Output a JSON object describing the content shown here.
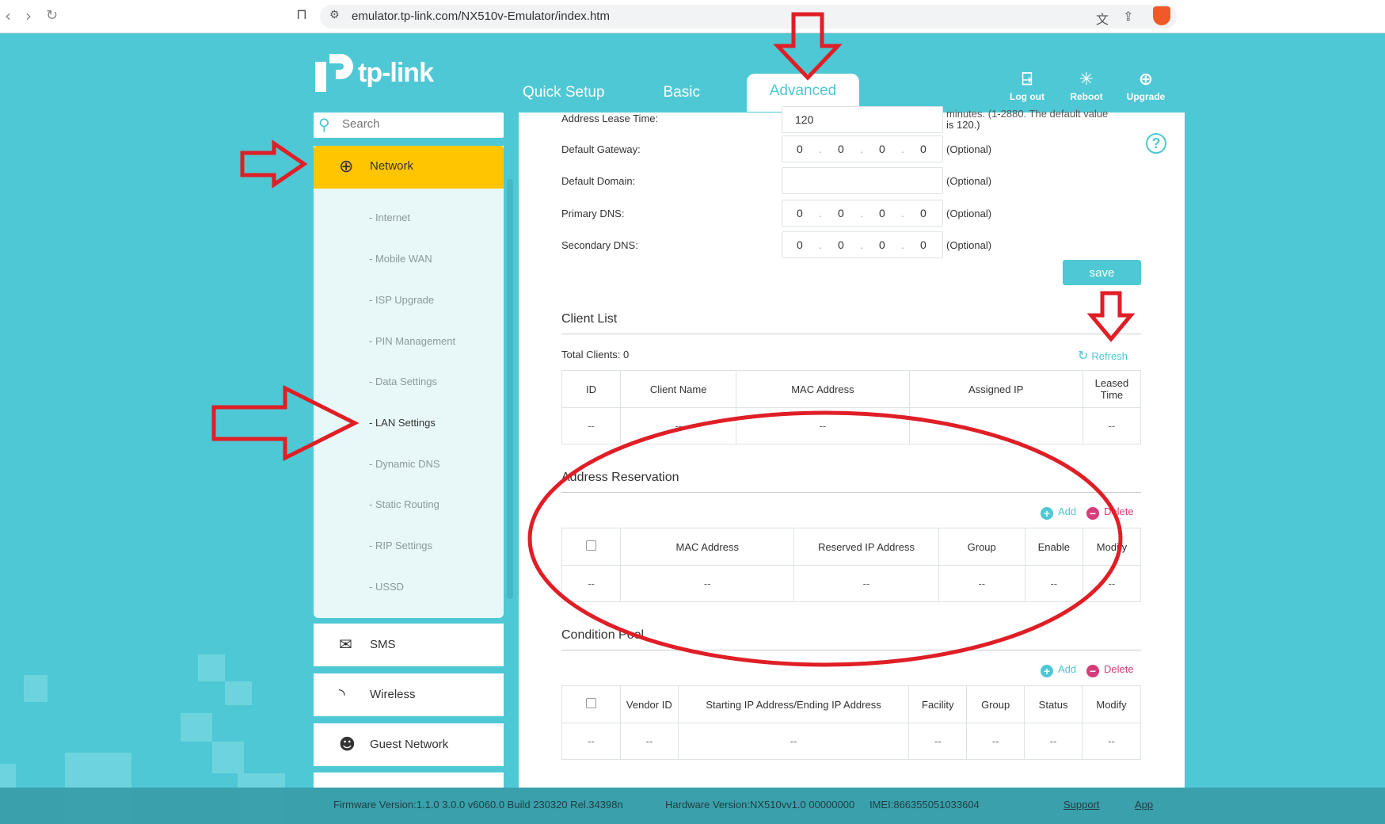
{
  "browser": {
    "url": "emulator.tp-link.com/NX510v-Emulator/index.htm"
  },
  "brand": {
    "logo_text": "tp-link",
    "accent": "#4ec8d4",
    "active_color": "#ffc500"
  },
  "top_nav": {
    "tabs": [
      {
        "label": "Quick Setup"
      },
      {
        "label": "Basic"
      },
      {
        "label": "Advanced",
        "active": true
      }
    ],
    "tools": [
      {
        "label": "Log out",
        "icon": "logout-icon"
      },
      {
        "label": "Reboot",
        "icon": "reboot-icon"
      },
      {
        "label": "Upgrade",
        "icon": "upgrade-icon"
      }
    ]
  },
  "sidebar": {
    "search_placeholder": "Search",
    "active_section": {
      "label": "Network",
      "icon": "globe-icon"
    },
    "sub_items": [
      {
        "label": "- Internet"
      },
      {
        "label": "- Mobile WAN"
      },
      {
        "label": "- ISP Upgrade"
      },
      {
        "label": "- PIN Management"
      },
      {
        "label": "- Data Settings"
      },
      {
        "label": "- LAN Settings",
        "current": true
      },
      {
        "label": "- Dynamic DNS"
      },
      {
        "label": "- Static Routing"
      },
      {
        "label": "- RIP Settings"
      },
      {
        "label": "- USSD"
      }
    ],
    "sections": [
      {
        "label": "SMS",
        "icon": "envelope-icon"
      },
      {
        "label": "Wireless",
        "icon": "wireless-icon"
      },
      {
        "label": "Guest Network",
        "icon": "guest-icon"
      }
    ]
  },
  "form": {
    "lease_label": "Address Lease Time:",
    "lease_value": "120",
    "lease_hint_1": "minutes. (1-2880. The default value",
    "lease_hint_2": "is 120.)",
    "gateway_label": "Default Gateway:",
    "domain_label": "Default Domain:",
    "primary_dns_label": "Primary DNS:",
    "secondary_dns_label": "Secondary DNS:",
    "optional": "(Optional)",
    "octet": "0",
    "save_label": "save"
  },
  "client_list": {
    "title": "Client List",
    "total": "Total Clients: 0",
    "refresh_label": "Refresh",
    "columns": [
      "ID",
      "Client Name",
      "MAC Address",
      "Assigned IP",
      "Leased Time"
    ],
    "row": [
      "--",
      "--",
      "--",
      "",
      "--"
    ]
  },
  "address_reservation": {
    "title": "Address Reservation",
    "add_label": "Add",
    "delete_label": "Delete",
    "columns": [
      "MAC Address",
      "Reserved IP Address",
      "Group",
      "Enable",
      "Modify"
    ],
    "row": [
      "--",
      "--",
      "--",
      "--",
      "--",
      "--"
    ]
  },
  "condition_pool": {
    "title": "Condition Pool",
    "add_label": "Add",
    "delete_label": "Delete",
    "columns": [
      "Vendor ID",
      "Starting IP Address/Ending IP Address",
      "Facility",
      "Group",
      "Status",
      "Modify"
    ],
    "row": [
      "--",
      "--",
      "--",
      "--",
      "--",
      "--",
      "--"
    ]
  },
  "footer": {
    "firmware": "Firmware Version:1.1.0 3.0.0 v6060.0 Build 230320 Rel.34398n",
    "hardware": "Hardware Version:NX510vv1.0 00000000",
    "imei": "IMEI:866355051033604",
    "support": "Support",
    "app": "App"
  }
}
